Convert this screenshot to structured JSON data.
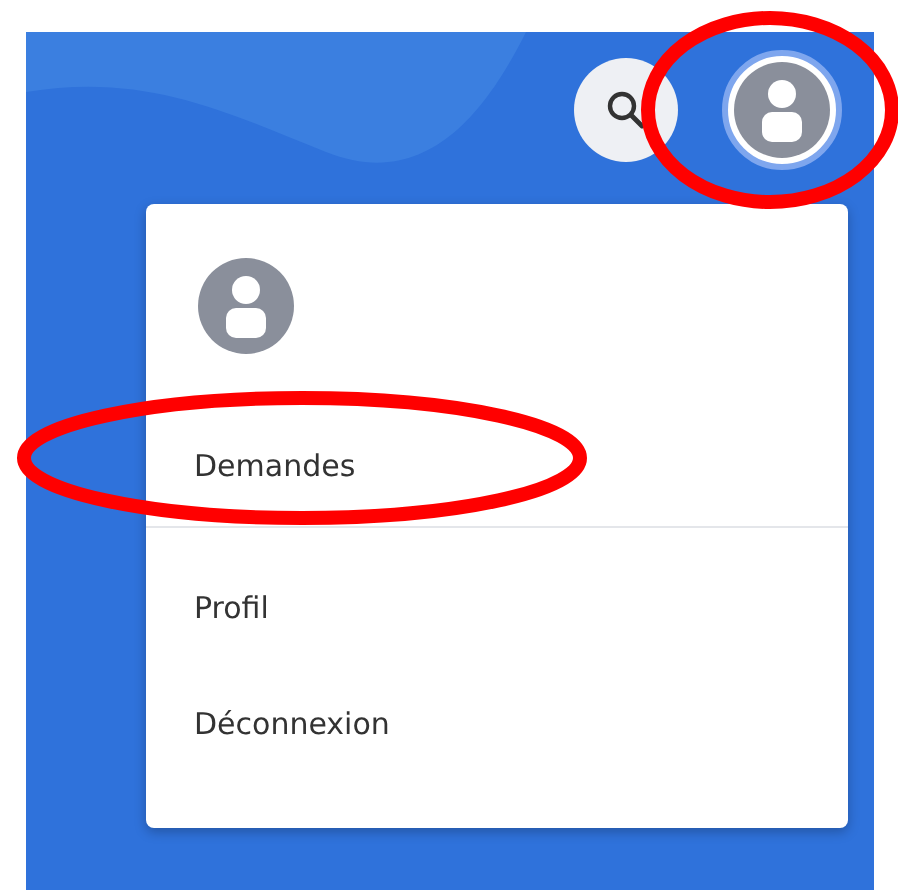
{
  "menu": {
    "items": [
      {
        "kind": "item",
        "label": "Demandes"
      },
      {
        "kind": "divider"
      },
      {
        "kind": "item",
        "label": "Profil"
      },
      {
        "kind": "item",
        "label": "Déconnexion"
      }
    ]
  }
}
